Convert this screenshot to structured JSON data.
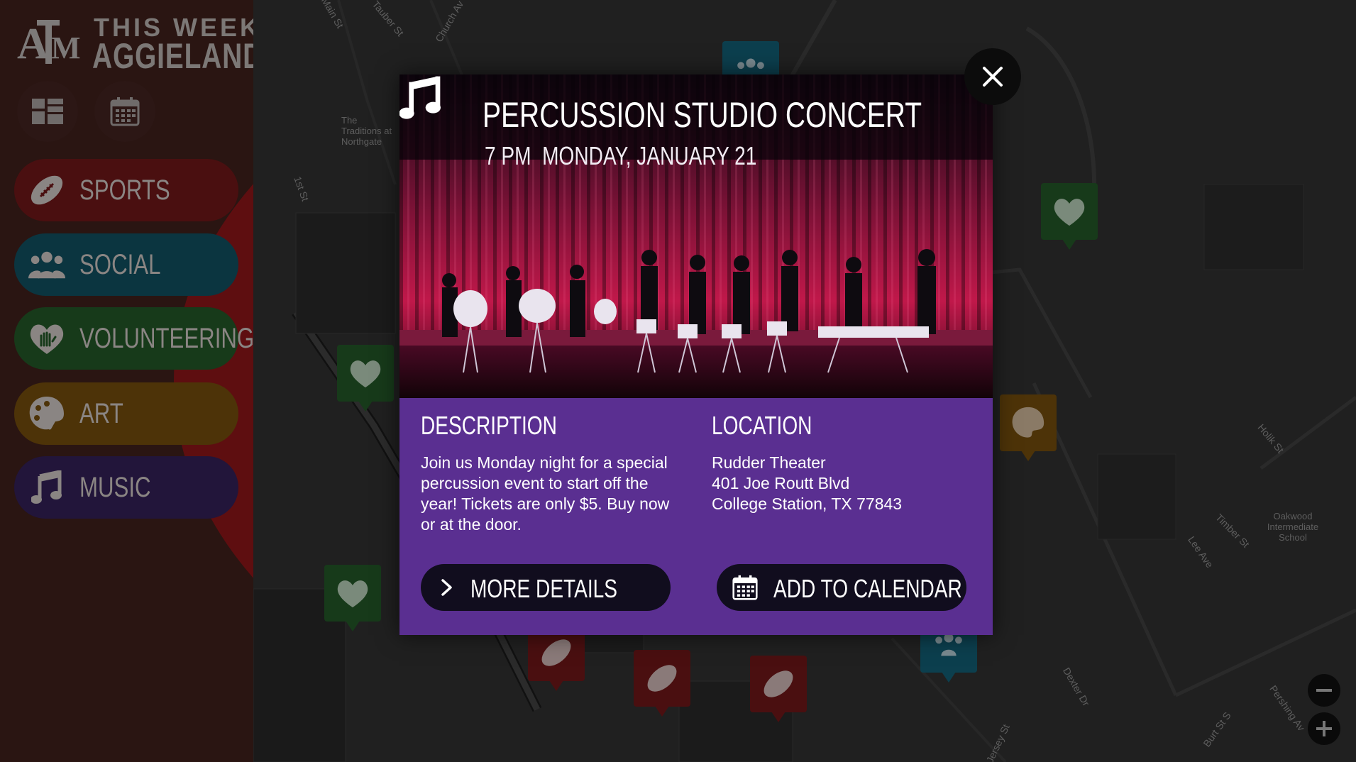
{
  "logo": {
    "line1": "THIS WEEK IN",
    "line2": "AGGIELAND",
    "mark": "ATM"
  },
  "view_toggle": [
    {
      "name": "grid-view",
      "icon": "grid-icon"
    },
    {
      "name": "calendar-view",
      "icon": "calendar-icon"
    },
    {
      "name": "map-view",
      "icon": "map-pin-icon",
      "active": true
    }
  ],
  "categories": [
    {
      "label": "SPORTS",
      "icon": "football-icon",
      "color": "#4a0f10"
    },
    {
      "label": "SOCIAL",
      "icon": "people-icon",
      "color": "#0b3540"
    },
    {
      "label": "VOLUNTEERING",
      "icon": "heart-hand-icon",
      "color": "#173a1a"
    },
    {
      "label": "ART",
      "icon": "palette-icon",
      "color": "#4d3308"
    },
    {
      "label": "MUSIC",
      "icon": "music-note-icon",
      "color": "#22153a"
    }
  ],
  "map": {
    "streets": [
      "Main St",
      "Tauber St",
      "Church Av",
      "1st St",
      "Holik St",
      "Timber St",
      "Lee Ave",
      "Dexter Dr",
      "Pershing Av",
      "Burt St S",
      "Jersey St"
    ],
    "places": [
      "The Traditions at Northgate",
      "Oakwood Intermediate School"
    ]
  },
  "event": {
    "title": "PERCUSSION STUDIO CONCERT",
    "time": "7 PM",
    "date": "MONDAY, JANUARY 21",
    "description_heading": "DESCRIPTION",
    "description": "Join us Monday night for a special percussion event to start off the year! Tickets are only $5. Buy now or at the door.",
    "location_heading": "LOCATION",
    "location": {
      "venue": "Rudder Theater",
      "street": "401 Joe Routt Blvd",
      "city": "College Station, TX 77843"
    },
    "more_details_label": "MORE DETAILS",
    "add_calendar_label": "ADD TO CALENDAR",
    "accent": "#5a2f91"
  },
  "colors": {
    "sports": "#8c1418",
    "social": "#0c5d74",
    "volunteer": "#1f6a25",
    "art": "#8a5a0d",
    "music": "#5a2f91"
  }
}
